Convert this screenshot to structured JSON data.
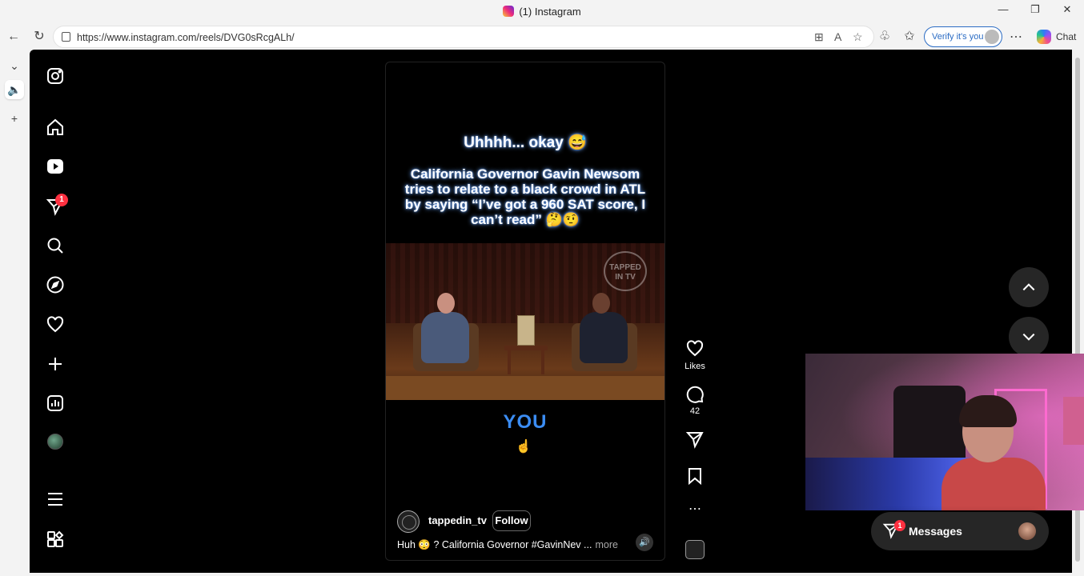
{
  "window": {
    "title": "(1) Instagram",
    "minimize": "—",
    "maximize": "❐",
    "close": "✕"
  },
  "browser": {
    "url": "https://www.instagram.com/reels/DVG0sRcgALh/",
    "verify_label": "Verify it's you",
    "chat_label": "Chat",
    "more": "⋯"
  },
  "sidebar": {
    "notifications_badge": "1"
  },
  "reel": {
    "overlay_title": "Uhhhh... okay 😅",
    "overlay_text": "California Governor Gavin Newsom tries to relate to a black crowd in ATL by saying “I’ve got a 960 SAT score, I can’t read” 🤔🤨",
    "subtitle_word": "YOU",
    "watermark": "TAPPED IN TV",
    "author": "tappedin_tv",
    "follow_label": "Follow",
    "caption": "Huh 😳 ? California Governor #GavinNev",
    "caption_ellipsis": "...",
    "more_label": "more"
  },
  "actions": {
    "likes_label": "Likes",
    "comments_count": "42",
    "more": "⋯"
  },
  "messages": {
    "label": "Messages",
    "badge": "1"
  },
  "colors": {
    "background": "#000000",
    "badge": "#ff3040",
    "subtitle": "#3b8cf2",
    "verify": "#2b6cc4"
  }
}
